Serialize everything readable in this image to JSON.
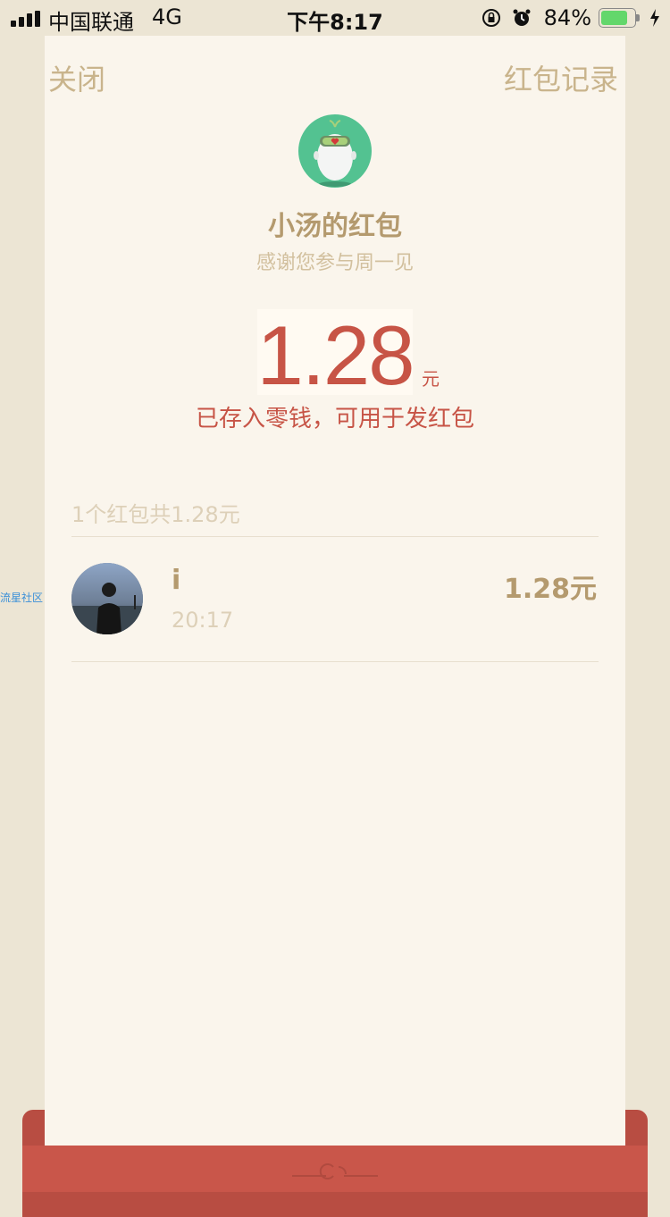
{
  "status_bar": {
    "carrier": "中国联通",
    "network": "4G",
    "time": "下午8:17",
    "battery_percent": "84%",
    "battery_level": 0.84,
    "icons": [
      "signal-icon",
      "rotation-lock-icon",
      "alarm-icon",
      "battery-icon",
      "charging-icon"
    ]
  },
  "nav": {
    "close_label": "关闭",
    "records_label": "红包记录"
  },
  "packet": {
    "sender_name": "小汤的红包",
    "blessing": "感谢您参与周一见",
    "amount": "1.28",
    "amount_unit": "元",
    "saved_note": "已存入零钱，可用于发红包"
  },
  "summary": {
    "text": "1个红包共1.28元"
  },
  "records": [
    {
      "name": "i",
      "time": "20:17",
      "amount": "1.28元"
    }
  ],
  "watermark": "流星社区",
  "colors": {
    "accent_red": "#c75446",
    "gold_text": "#b49a6e",
    "muted_text": "#d2c09e",
    "card_bg": "#faf5ec",
    "page_bg": "#ece5d4",
    "avatar_green": "#53c291"
  }
}
